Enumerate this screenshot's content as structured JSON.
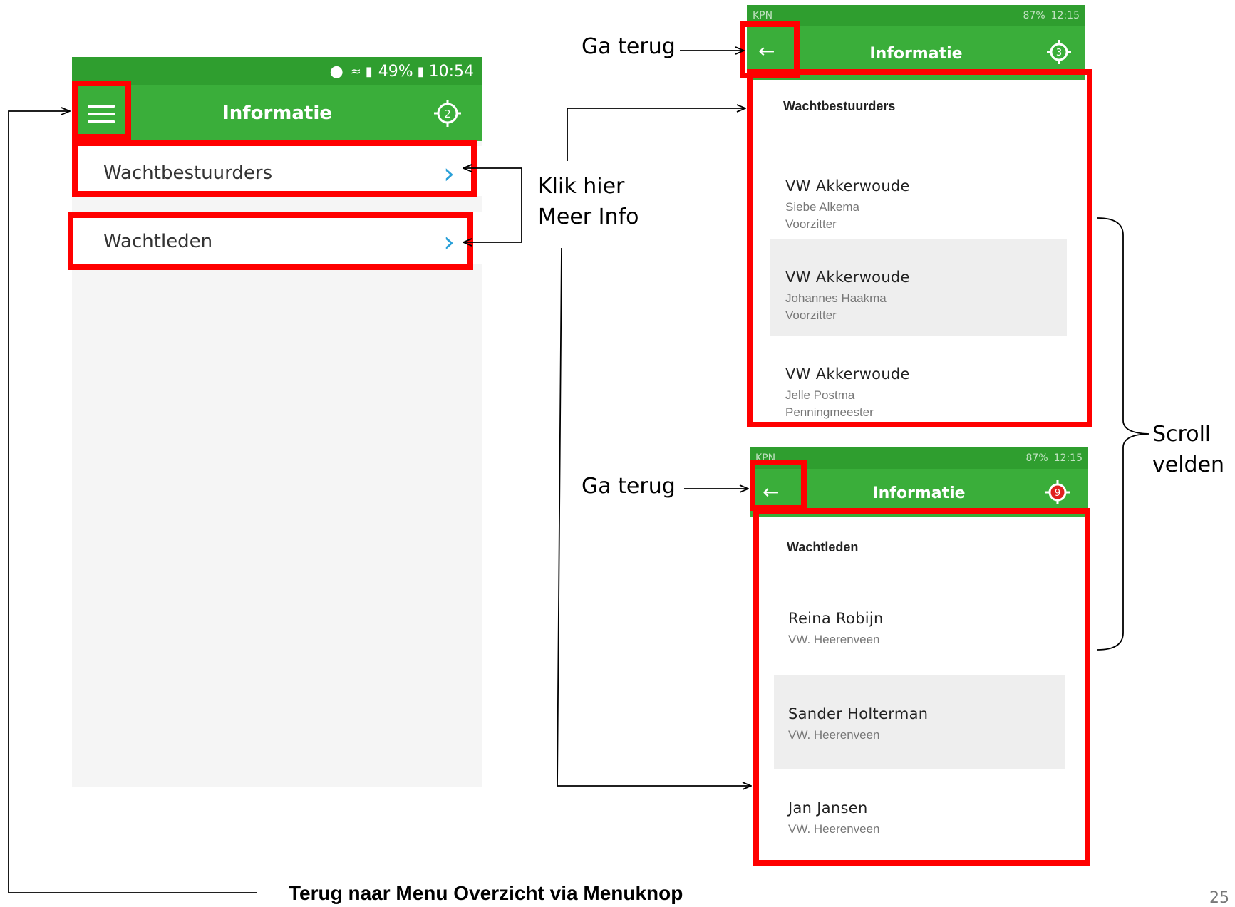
{
  "main_screen": {
    "status": {
      "percent": "49%",
      "time": "10:54"
    },
    "title": "Informatie",
    "badge": "2",
    "rows": [
      {
        "label": "Wachtbestuurders"
      },
      {
        "label": "Wachtleden"
      }
    ]
  },
  "bestuurders_screen": {
    "status": {
      "carrier": "KPN",
      "percent": "87%",
      "time": "12:15"
    },
    "title": "Informatie",
    "badge": "3",
    "section": "Wachtbestuurders",
    "items": [
      {
        "title": "VW Akkerwoude",
        "name": "Siebe Alkema",
        "role": "Voorzitter"
      },
      {
        "title": "VW Akkerwoude",
        "name": "Johannes Haakma",
        "role": "Voorzitter"
      },
      {
        "title": "VW Akkerwoude",
        "name": "Jelle Postma",
        "role": "Penningmeester"
      }
    ]
  },
  "leden_screen": {
    "status": {
      "carrier": "KPN",
      "percent": "87%",
      "time": "12:15"
    },
    "title": "Informatie",
    "badge": "9",
    "section": "Wachtleden",
    "items": [
      {
        "name": "Reina Robijn",
        "org": "VW. Heerenveen"
      },
      {
        "name": "Sander Holterman",
        "org": "VW. Heerenveen"
      },
      {
        "name": "Jan Jansen",
        "org": "VW. Heerenveen"
      }
    ]
  },
  "annotations": {
    "back_top": "Ga terug",
    "back_bottom": "Ga terug",
    "click_line1": "Klik hier",
    "click_line2": "Meer Info",
    "scroll_line1": "Scroll",
    "scroll_line2": "velden",
    "footer": "Terug naar Menu Overzicht via Menuknop",
    "page_number": "25"
  },
  "colors": {
    "appbar_green": "#3aae3a",
    "status_green": "#2f9e2f",
    "highlight_red": "#ff0000",
    "chevron_blue": "#2aa0d8"
  }
}
